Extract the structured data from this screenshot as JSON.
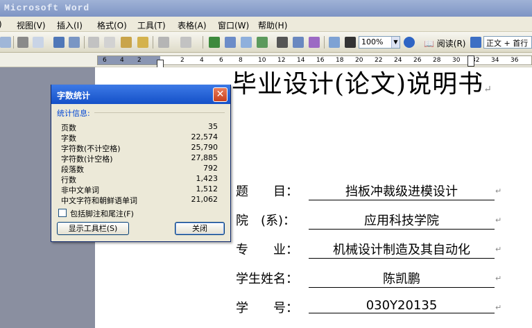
{
  "app": {
    "title": "Microsoft Word"
  },
  "menu": [
    "视图(V)",
    "插入(I)",
    "格式(O)",
    "工具(T)",
    "表格(A)",
    "窗口(W)",
    "帮助(H)"
  ],
  "toolbar": {
    "zoom": "100%",
    "read_label": "阅读(R)",
    "style_value": "正文 + 首行"
  },
  "ruler": {
    "ticks": [
      "6",
      "4",
      "2",
      "2",
      "4",
      "6",
      "8",
      "10",
      "12",
      "14",
      "16",
      "18",
      "20",
      "22",
      "24",
      "26",
      "28",
      "30",
      "32",
      "34",
      "36"
    ]
  },
  "document": {
    "title": "毕业设计(论文)说明书",
    "fields": [
      {
        "label": "题　　目：",
        "value": "挡板冲裁级进模设计"
      },
      {
        "label": "院　(系)：",
        "value": "应用科技学院"
      },
      {
        "label": "专　　业：",
        "value": "机械设计制造及其自动化"
      },
      {
        "label": "学生姓名：",
        "value": "陈凯鹏"
      },
      {
        "label": "学　　号：",
        "value": "030Y20135"
      }
    ],
    "paragraph_mark": "↵"
  },
  "dialog": {
    "title": "字数统计",
    "section": "统计信息:",
    "stats": [
      {
        "label": "页数",
        "value": "35"
      },
      {
        "label": "字数",
        "value": "22,574"
      },
      {
        "label": "字符数(不计空格)",
        "value": "25,790"
      },
      {
        "label": "字符数(计空格)",
        "value": "27,885"
      },
      {
        "label": "段落数",
        "value": "792"
      },
      {
        "label": "行数",
        "value": "1,423"
      },
      {
        "label": "非中文单词",
        "value": "1,512"
      },
      {
        "label": "中文字符和朝鲜语单词",
        "value": "21,062"
      }
    ],
    "checkbox_label": "包括脚注和尾注(F)",
    "show_toolbar_button": "显示工具栏(S)",
    "close_button": "关闭"
  }
}
